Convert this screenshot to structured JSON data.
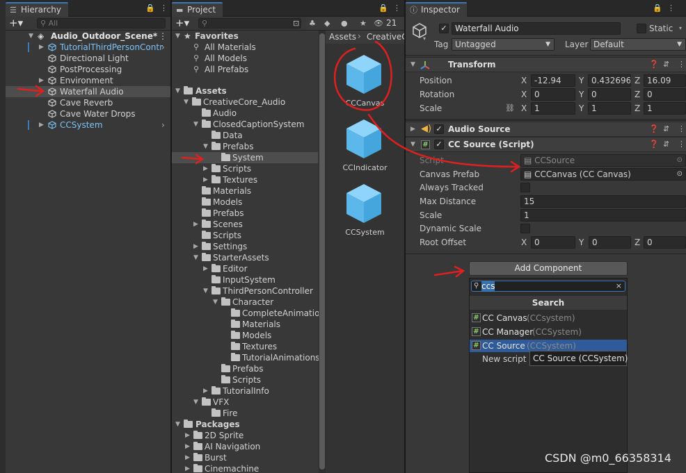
{
  "hierarchy": {
    "tab": "Hierarchy",
    "search_placeholder": "All",
    "scene": "Audio_Outdoor_Scene*",
    "items": [
      "TutorialThirdPersonContr",
      "Directional Light",
      "PostProcessing",
      "Environment",
      "Waterfall Audio",
      "Cave Reverb",
      "Cave Water Drops",
      "CCSystem"
    ]
  },
  "project": {
    "tab": "Project",
    "badge": "21",
    "breadcrumb": [
      "Assets",
      "CreativeC"
    ],
    "favorites": {
      "label": "Favorites",
      "items": [
        "All Materials",
        "All Models",
        "All Prefabs"
      ]
    },
    "assets_label": "Assets",
    "packages_label": "Packages",
    "tree": [
      "CreativeCore_Audio",
      "Audio",
      "ClosedCaptionSystem",
      "Data",
      "Prefabs",
      "System",
      "Scripts",
      "Textures",
      "Materials",
      "Models",
      "Prefabs",
      "Scenes",
      "Scripts",
      "Settings",
      "StarterAssets",
      "Editor",
      "InputSystem",
      "ThirdPersonController",
      "Character",
      "CompleteAnimation",
      "Materials",
      "Models",
      "Textures",
      "TutorialAnimations",
      "Prefabs",
      "Scripts",
      "TutorialInfo",
      "VFX",
      "Fire"
    ],
    "packages": [
      "2D Sprite",
      "AI Navigation",
      "Burst",
      "Cinemachine"
    ],
    "grid": [
      "CCCanvas",
      "CCIndicator",
      "CCSystem"
    ]
  },
  "inspector": {
    "tab": "Inspector",
    "object_name": "Waterfall Audio",
    "static_label": "Static",
    "tag_label": "Tag",
    "tag_value": "Untagged",
    "layer_label": "Layer",
    "layer_value": "Default",
    "transform": {
      "title": "Transform",
      "position_label": "Position",
      "rotation_label": "Rotation",
      "scale_label": "Scale",
      "axes": [
        "X",
        "Y",
        "Z"
      ],
      "position": [
        "-12.94",
        "0.432696",
        "16.09"
      ],
      "rotation": [
        "0",
        "0",
        "0"
      ],
      "scale": [
        "1",
        "1",
        "1"
      ]
    },
    "audio_source": {
      "title": "Audio Source"
    },
    "cc_source": {
      "title": "CC Source (Script)",
      "script_label": "Script",
      "script_value": "CCSource",
      "canvas_prefab_label": "Canvas Prefab",
      "canvas_prefab_value": "CCCanvas (CC Canvas)",
      "always_tracked_label": "Always Tracked",
      "max_distance_label": "Max Distance",
      "max_distance_value": "15",
      "scale_label": "Scale",
      "scale_value": "1",
      "dynamic_scale_label": "Dynamic Scale",
      "root_offset_label": "Root Offset",
      "root_offset": [
        "0",
        "0",
        "0"
      ]
    },
    "add_component": {
      "button": "Add Component",
      "search_value": "ccs",
      "search_title": "Search",
      "results": [
        {
          "name": "CC Canvas",
          "ns": "(CCsystem)"
        },
        {
          "name": "CC Manager",
          "ns": "(CCSystem)"
        },
        {
          "name": "CC Source",
          "ns": "(CCSystem)"
        }
      ],
      "new_script": "New script",
      "tooltip": "CC Source (CCSystem)"
    }
  },
  "watermark": "CSDN @m0_66358314"
}
